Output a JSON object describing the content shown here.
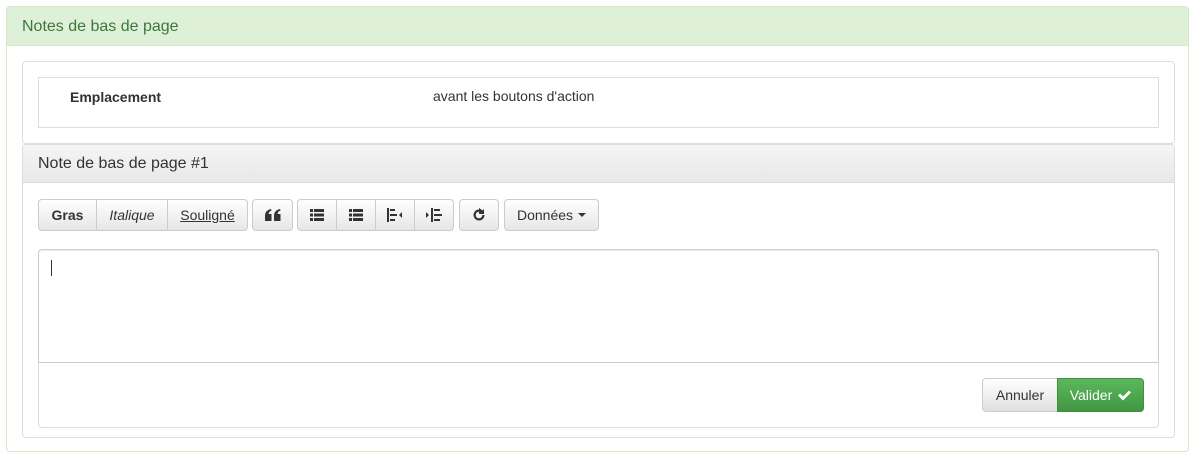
{
  "outer_panel": {
    "title": "Notes de bas de page"
  },
  "settings": {
    "label": "Emplacement",
    "value": "avant les boutons d'action"
  },
  "note_panel": {
    "title": "Note de bas de page #1"
  },
  "toolbar": {
    "bold_label": "Gras",
    "italic_label": "Italique",
    "underline_label": "Souligné",
    "data_label": "Données",
    "icons": [
      "quote-icon",
      "unordered-list-icon",
      "ordered-list-icon",
      "outdent-icon",
      "indent-icon",
      "redo-icon"
    ]
  },
  "editor": {
    "value": ""
  },
  "footer": {
    "cancel_label": "Annuler",
    "validate_label": "Valider"
  },
  "colors": {
    "success_header_bg": "#dff0d8",
    "success_header_text": "#3c763d",
    "validate_button": "#5cb85c"
  }
}
